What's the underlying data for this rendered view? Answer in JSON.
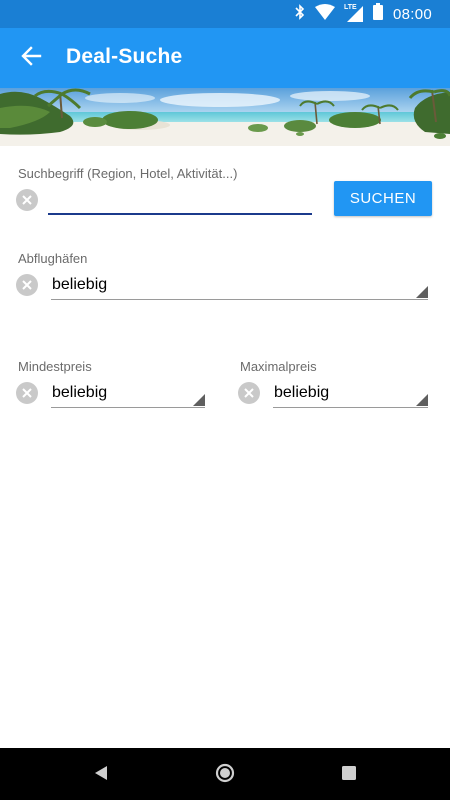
{
  "status_bar": {
    "time": "08:00",
    "icons": [
      "bluetooth-icon",
      "wifi-icon",
      "lte-signal-icon",
      "battery-icon"
    ],
    "network_label": "LTE"
  },
  "app_bar": {
    "title": "Deal-Suche",
    "back_icon": "arrow-back-icon",
    "color": "#2196f3"
  },
  "search": {
    "label": "Suchbegriff (Region, Hotel, Aktivität...)",
    "value": "",
    "button_label": "SUCHEN"
  },
  "airports": {
    "label": "Abflughäfen",
    "value": "beliebig"
  },
  "min_price": {
    "label": "Mindestpreis",
    "value": "beliebig"
  },
  "max_price": {
    "label": "Maximalpreis",
    "value": "beliebig"
  },
  "nav": {
    "icons": [
      "nav-back-icon",
      "nav-home-icon",
      "nav-recents-icon"
    ]
  }
}
